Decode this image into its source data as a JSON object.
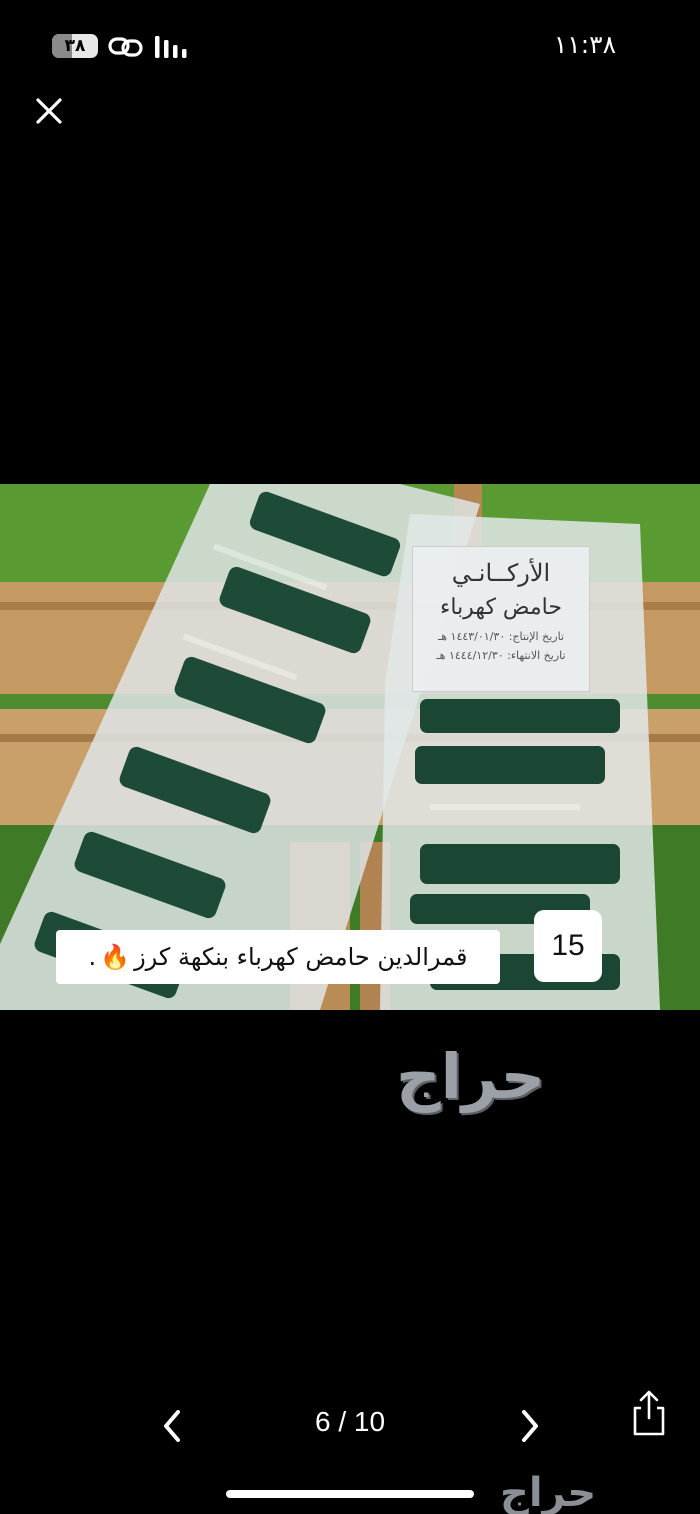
{
  "status_bar": {
    "time": "١١:٣٨",
    "battery": "٣٨",
    "icons": [
      "link-icon",
      "signal-icon"
    ]
  },
  "viewer": {
    "close_icon": "close-icon",
    "page_counter": "6 / 10",
    "prev_icon": "chevron-left-icon",
    "next_icon": "chevron-right-icon",
    "share_icon": "share-icon"
  },
  "photo": {
    "badge_number": "15",
    "caption": "قمرالدين حامض كهرباء بنكهة كرز",
    "caption_emoji": "🔥",
    "caption_suffix": ".",
    "label": {
      "brand": "الأركــانـي",
      "type": "حامض كهرباء",
      "date_line_1": "تاريخ الإنتاج: ١٤٤٣/٠١/٣٠ هـ",
      "date_line_2": "تاريخ الانتهاء: ١٤٤٤/١٢/٣٠ هـ"
    }
  },
  "watermark": "حراج",
  "corner_watermark": "حراج"
}
